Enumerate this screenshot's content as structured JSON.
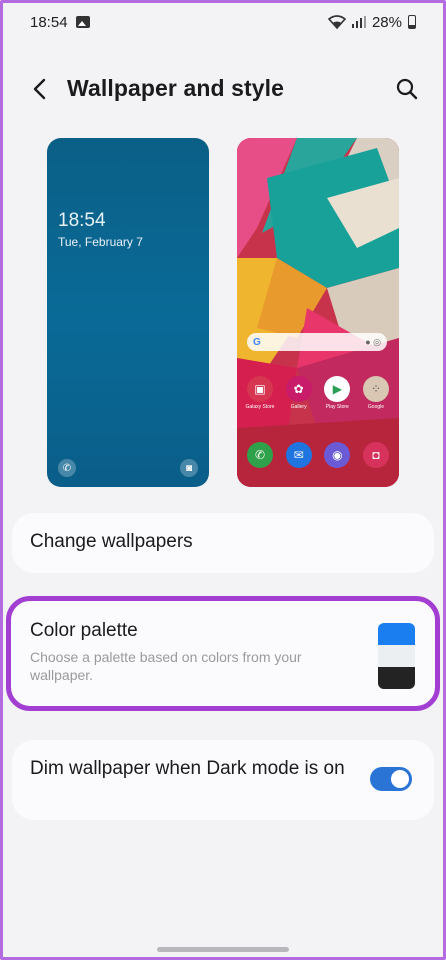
{
  "status_bar": {
    "time": "18:54",
    "battery": "28%",
    "icons": [
      "gallery-icon",
      "wifi-icon",
      "signal-icon",
      "battery-icon"
    ]
  },
  "header": {
    "title": "Wallpaper and style",
    "back_icon": "back-arrow-icon",
    "search_icon": "search-icon"
  },
  "lock_preview": {
    "time": "18:54",
    "date": "Tue, February 7",
    "bg_color": "#0a6a97"
  },
  "home_preview": {
    "search_letter": "G",
    "apps_row1": [
      {
        "label": "Galaxy Store",
        "color": "#d63650",
        "glyph": "🛍"
      },
      {
        "label": "Gallery",
        "color": "#c81c6a",
        "glyph": "✿"
      },
      {
        "label": "Play Store",
        "color": "#ffffff",
        "glyph": "▶"
      },
      {
        "label": "Google",
        "color": "#d9c7b3",
        "glyph": "⁘"
      }
    ],
    "apps_row2": [
      {
        "label": "",
        "color": "#2fa14a",
        "glyph": "✆"
      },
      {
        "label": "",
        "color": "#1f74e0",
        "glyph": "✉"
      },
      {
        "label": "",
        "color": "#6a5ad6",
        "glyph": "◉"
      },
      {
        "label": "",
        "color": "#d7325b",
        "glyph": "◘"
      }
    ]
  },
  "change_wallpapers": {
    "label": "Change wallpapers"
  },
  "color_palette": {
    "title": "Color palette",
    "description": "Choose a palette based on colors from your wallpaper.",
    "swatches": [
      "#1a7ef0",
      "#eceff2",
      "#232323"
    ],
    "highlight_color": "#a23fd2"
  },
  "dim_wallpaper": {
    "label": "Dim wallpaper when Dark mode is on",
    "enabled": true,
    "toggle_color": "#2a74d6"
  }
}
